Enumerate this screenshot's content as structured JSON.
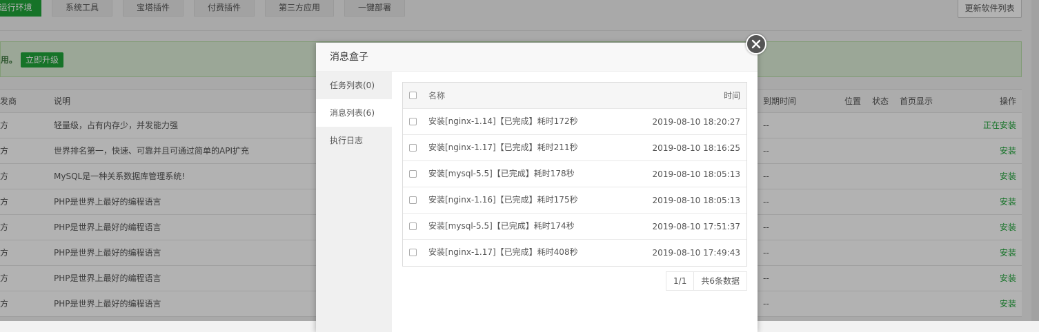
{
  "tabs": [
    {
      "label": "运行环境",
      "active": true
    },
    {
      "label": "系统工具",
      "active": false
    },
    {
      "label": "宝塔插件",
      "active": false
    },
    {
      "label": "付费插件",
      "active": false
    },
    {
      "label": "第三方应用",
      "active": false
    },
    {
      "label": "一键部署",
      "active": false
    }
  ],
  "refresh_label": "更新软件列表",
  "notice": {
    "text": "用。",
    "upgrade_label": "立即升级"
  },
  "plugin_table": {
    "headers": {
      "developer": "发商",
      "desc": "说明",
      "expiry": "到期时间",
      "position": "位置",
      "status": "状态",
      "home": "首页显示",
      "op": "操作"
    },
    "rows": [
      {
        "developer": "方",
        "desc": "轻量级，占有内存少，并发能力强",
        "expiry": "--",
        "op": "正在安装"
      },
      {
        "developer": "方",
        "desc": "世界排名第一，快速、可靠并且可通过简单的API扩充",
        "expiry": "--",
        "op": "安装"
      },
      {
        "developer": "方",
        "desc": "MySQL是一种关系数据库管理系统!",
        "expiry": "--",
        "op": "安装"
      },
      {
        "developer": "方",
        "desc": "PHP是世界上最好的编程语言",
        "expiry": "--",
        "op": "安装"
      },
      {
        "developer": "方",
        "desc": "PHP是世界上最好的编程语言",
        "expiry": "--",
        "op": "安装"
      },
      {
        "developer": "方",
        "desc": "PHP是世界上最好的编程语言",
        "expiry": "--",
        "op": "安装"
      },
      {
        "developer": "方",
        "desc": "PHP是世界上最好的编程语言",
        "expiry": "--",
        "op": "安装"
      },
      {
        "developer": "方",
        "desc": "PHP是世界上最好的编程语言",
        "expiry": "--",
        "op": "安装"
      }
    ]
  },
  "modal": {
    "title": "消息盒子",
    "side_items": [
      {
        "label": "任务列表(0)",
        "active": false
      },
      {
        "label": "消息列表(6)",
        "active": true
      },
      {
        "label": "执行日志",
        "active": false
      }
    ],
    "table": {
      "headers": {
        "name": "名称",
        "time": "时间"
      },
      "rows": [
        {
          "name": "安装[nginx-1.14]【已完成】耗时172秒",
          "time": "2019-08-10 18:20:27"
        },
        {
          "name": "安装[nginx-1.17]【已完成】耗时211秒",
          "time": "2019-08-10 18:16:25"
        },
        {
          "name": "安装[mysql-5.5]【已完成】耗时178秒",
          "time": "2019-08-10 18:05:13"
        },
        {
          "name": "安装[nginx-1.16]【已完成】耗时175秒",
          "time": "2019-08-10 18:05:13"
        },
        {
          "name": "安装[mysql-5.5]【已完成】耗时174秒",
          "time": "2019-08-10 17:51:37"
        },
        {
          "name": "安装[nginx-1.17]【已完成】耗时408秒",
          "time": "2019-08-10 17:49:43"
        }
      ]
    },
    "pagination": {
      "page": "1/1",
      "total": "共6条数据"
    }
  },
  "colors": {
    "accent": "#20a53a",
    "overlay": "rgba(0,0,0,0.3)"
  },
  "icons": {
    "close": "close-icon"
  }
}
